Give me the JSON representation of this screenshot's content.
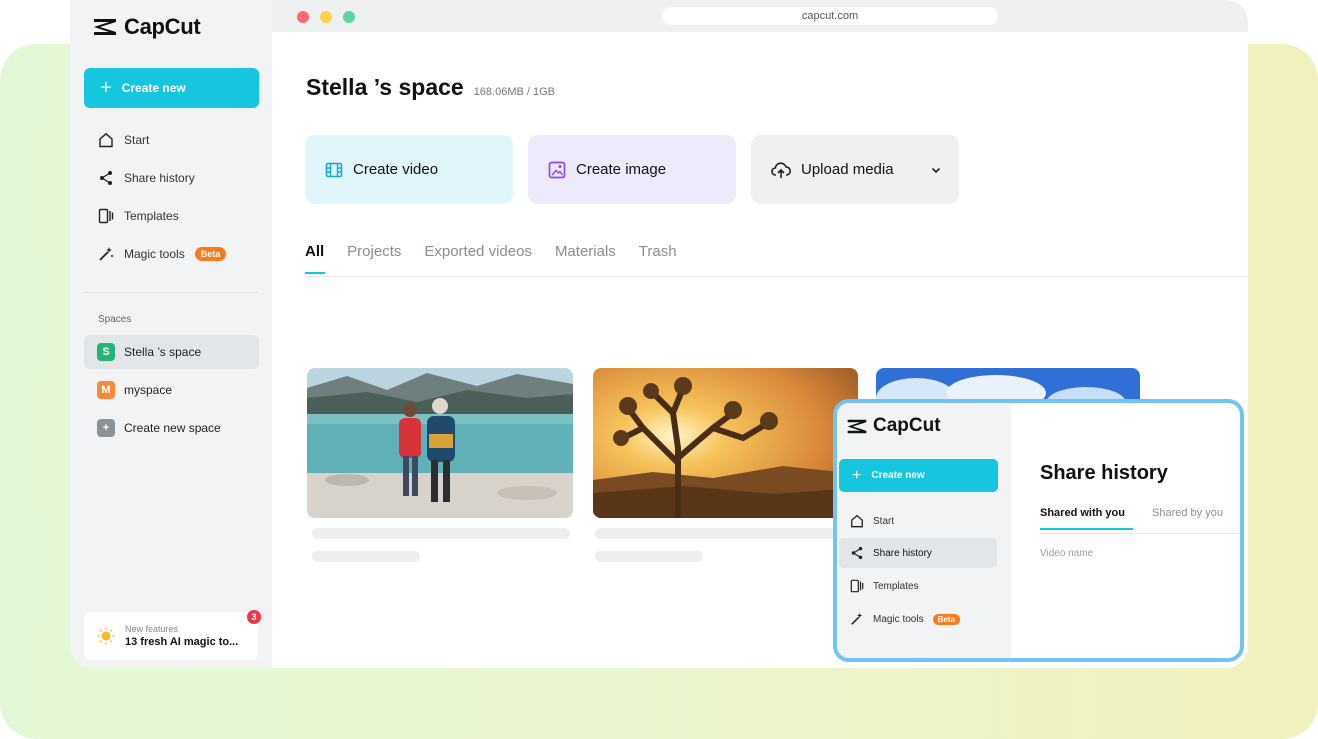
{
  "browser": {
    "url": "capcut.com"
  },
  "colors": {
    "accent": "#16c6df",
    "beta": "#ff7a1a",
    "badge": "#f2364a",
    "popup_border": "#73c3f2"
  },
  "sidebar": {
    "brand": "CapCut",
    "create_label": "Create new",
    "nav": [
      {
        "label": "Start",
        "icon": "home-icon"
      },
      {
        "label": "Share history",
        "icon": "share-icon"
      },
      {
        "label": "Templates",
        "icon": "templates-icon"
      },
      {
        "label": "Magic tools",
        "icon": "magic-wand-icon",
        "badge": "Beta"
      }
    ],
    "spaces_heading": "Spaces",
    "spaces": [
      {
        "initial": "S",
        "label": "Stella ’s space",
        "color": "#22b573",
        "active": true
      },
      {
        "initial": "M",
        "label": "myspace",
        "color": "#f58a3a",
        "active": false
      },
      {
        "initial": "+",
        "label": "Create new space",
        "color": "#8c9196",
        "active": false
      }
    ],
    "new_features": {
      "small": "New features",
      "big": "13 fresh AI magic to...",
      "badge_count": "3"
    }
  },
  "main": {
    "title": "Stella ’s space",
    "storage": "168.06MB / 1GB",
    "actions": [
      {
        "label": "Create video",
        "icon": "film-icon",
        "bg": "#e0f6fb",
        "icon_color": "#16a9c8"
      },
      {
        "label": "Create image",
        "icon": "image-icon",
        "bg": "#efe9fc",
        "icon_color": "#8a4de6"
      },
      {
        "label": "Upload media",
        "icon": "cloud-upload-icon",
        "bg": "#eef0f2",
        "icon_color": "#222"
      }
    ],
    "tabs": [
      "All",
      "Projects",
      "Exported videos",
      "Materials",
      "Trash"
    ],
    "active_tab": "All"
  },
  "popup": {
    "brand": "CapCut",
    "create_label": "Create new",
    "nav": [
      {
        "label": "Start"
      },
      {
        "label": "Share history"
      },
      {
        "label": "Templates"
      },
      {
        "label": "Magic tools",
        "badge": "Beta"
      }
    ],
    "title": "Share history",
    "tab_active": "Shared with you",
    "tab_other": "Shared by you",
    "column": "Video name"
  }
}
